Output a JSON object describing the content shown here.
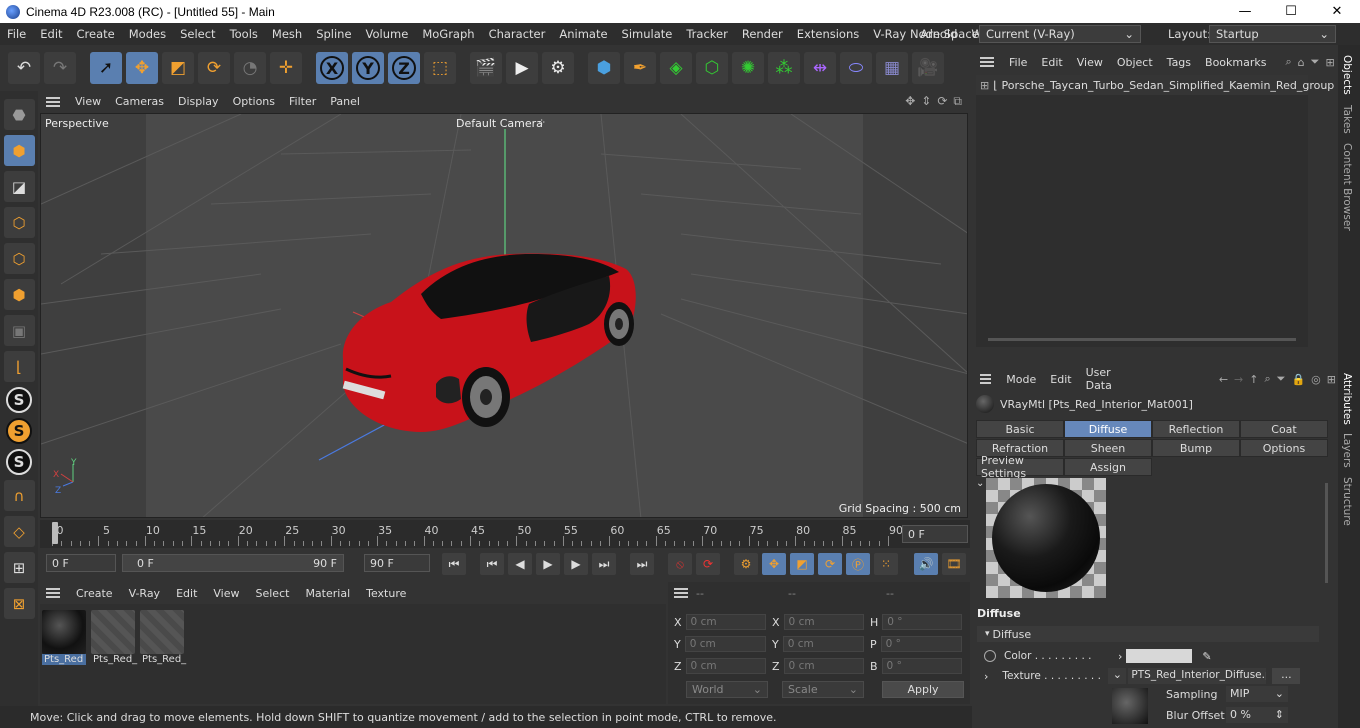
{
  "window": {
    "title": "Cinema 4D R23.008 (RC) - [Untitled 55] - Main",
    "minimize": "—",
    "maximize": "☐",
    "close": "✕"
  },
  "menubar": {
    "items": [
      "File",
      "Edit",
      "Create",
      "Modes",
      "Select",
      "Tools",
      "Mesh",
      "Spline",
      "Volume",
      "MoGraph",
      "Character",
      "Animate",
      "Simulate",
      "Tracker",
      "Render",
      "Extensions",
      "V-Ray",
      "Arnold",
      "Winc"
    ],
    "more": "▸",
    "node_space_label": "Node Space:",
    "node_space_value": "Current (V-Ray)",
    "layout_label": "Layout:",
    "layout_value": "Startup"
  },
  "viewport": {
    "menu": [
      "View",
      "Cameras",
      "Display",
      "Options",
      "Filter",
      "Panel"
    ],
    "projection": "Perspective",
    "camera": "Default Camera",
    "camera_icon": "⁘",
    "grid_spacing": "Grid Spacing : 500 cm",
    "axis_x": "X",
    "axis_y": "Y",
    "axis_z": "Z"
  },
  "timeline": {
    "ticks": [
      "0",
      "5",
      "10",
      "15",
      "20",
      "25",
      "30",
      "35",
      "40",
      "45",
      "50",
      "55",
      "60",
      "65",
      "70",
      "75",
      "80",
      "85",
      "90"
    ],
    "current_frame": "0 F"
  },
  "transport": {
    "start_field": "0 F",
    "range_start": "0 F",
    "range_end": "90 F",
    "end_field": "90 F"
  },
  "material_manager": {
    "menu": [
      "Create",
      "V-Ray",
      "Edit",
      "View",
      "Select",
      "Material",
      "Texture"
    ],
    "materials": [
      "Pts_Red",
      "Pts_Red_",
      "Pts_Red_"
    ]
  },
  "coordinates": {
    "header": [
      "--",
      "--",
      "--"
    ],
    "rows": [
      {
        "a": "X",
        "av": "0 cm",
        "b": "X",
        "bv": "0 cm",
        "c": "H",
        "cv": "0 °"
      },
      {
        "a": "Y",
        "av": "0 cm",
        "b": "Y",
        "bv": "0 cm",
        "c": "P",
        "cv": "0 °"
      },
      {
        "a": "Z",
        "av": "0 cm",
        "b": "Z",
        "bv": "0 cm",
        "c": "B",
        "cv": "0 °"
      }
    ],
    "space": "World",
    "mode": "Scale",
    "apply": "Apply"
  },
  "status": "Move: Click and drag to move elements. Hold down SHIFT to quantize movement / add to the selection in point mode, CTRL to remove.",
  "objects": {
    "menu": [
      "File",
      "Edit",
      "View",
      "Object",
      "Tags",
      "Bookmarks"
    ],
    "items": [
      "Porsche_Taycan_Turbo_Sedan_Simplified_Kaemin_Red_group"
    ]
  },
  "attributes": {
    "menu": [
      "Mode",
      "Edit",
      "User Data"
    ],
    "object_title": "VRayMtl [Pts_Red_Interior_Mat001]",
    "tabs_row1": [
      "Basic",
      "Diffuse",
      "Reflection",
      "Coat"
    ],
    "tabs_row2": [
      "Refraction",
      "Sheen",
      "Bump",
      "Options"
    ],
    "tabs_row3": [
      "Preview Settings",
      "Assign"
    ],
    "active_tab": "Diffuse",
    "section_title": "Diffuse",
    "group_title": "Diffuse",
    "color_label": "Color . . . . . . . . .",
    "texture_label": "Texture . . . . . . . . .",
    "texture_value": "PTS_Red_Interior_Diffuse.pn",
    "texture_more": "...",
    "sampling_label": "Sampling",
    "sampling_value": "MIP",
    "blur_label": "Blur Offset",
    "blur_value": "0 %"
  },
  "side_tabs": [
    "Objects",
    "Takes",
    "Content Browser",
    "Attributes",
    "Layers",
    "Structure"
  ],
  "colors": {
    "accent": "#5a7fb0",
    "car_red": "#c8121a",
    "viewport_bg": "#4a4a4a",
    "panel_bg": "#333333"
  }
}
